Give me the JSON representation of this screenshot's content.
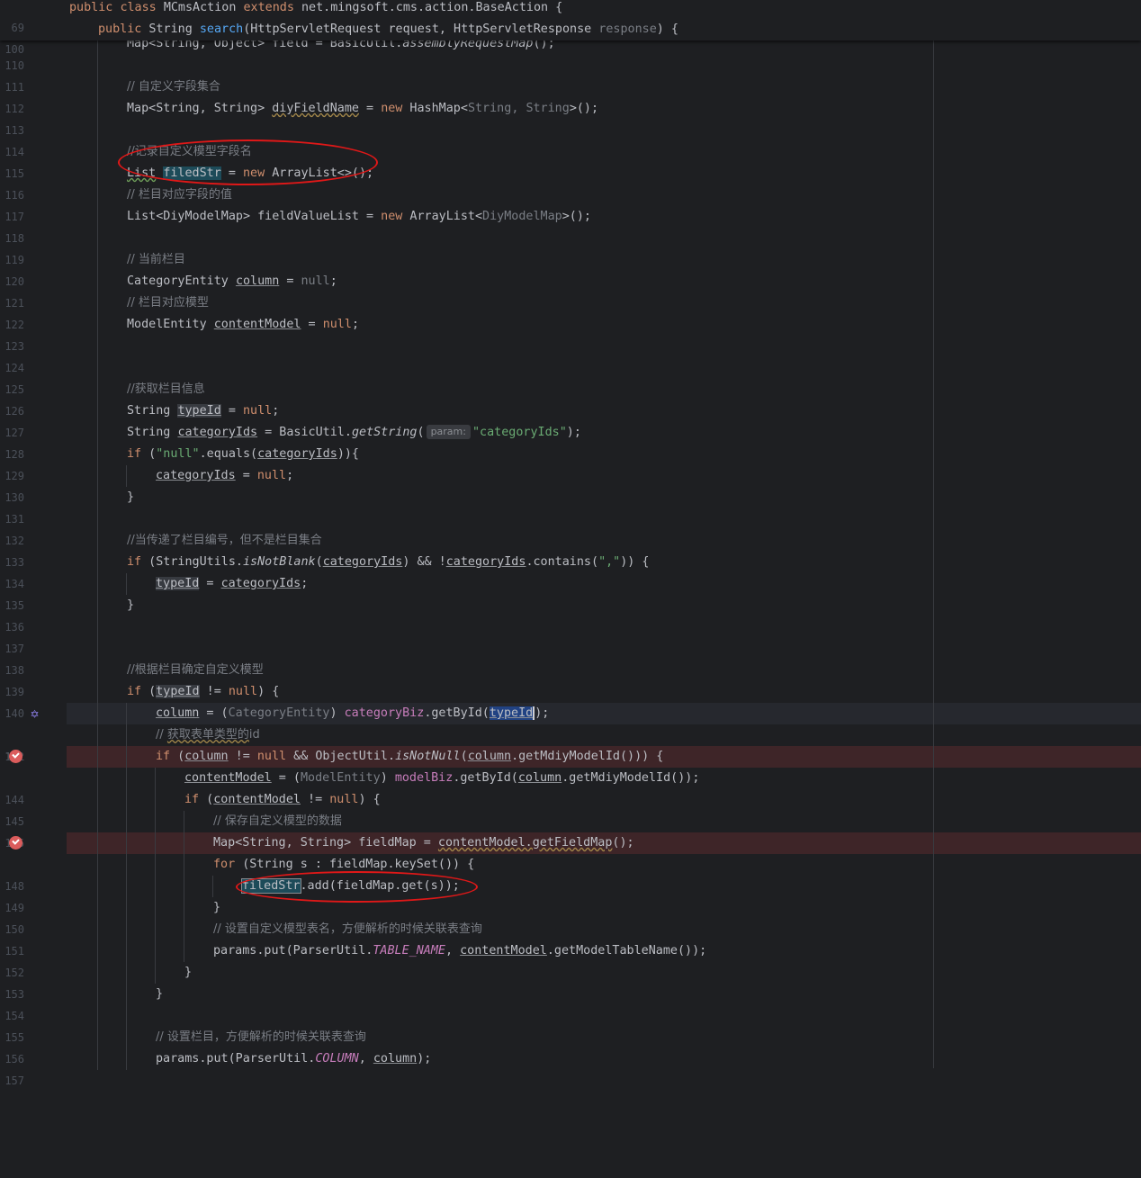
{
  "sticky": {
    "l69": {
      "num": "69",
      "kw1": "public",
      "kw2": "class",
      "name": "MCmsAction",
      "kw3": "extends",
      "base": "net.mingsoft.cms.action.BaseAction {"
    },
    "l100": {
      "num": "100",
      "kw1": "public",
      "t1": " String ",
      "method": "search",
      "p1": "(HttpServletRequest request, HttpServletResponse ",
      "resp": "response",
      "p2": ") {"
    }
  },
  "lines": {
    "l110": {
      "num": "110",
      "a": "Map<String, Object> field = BasicUtil.",
      "b": "assemblyRequestMap",
      "c": "();"
    },
    "l111": {
      "num": "111"
    },
    "l112": {
      "num": "112",
      "cm": "// 自定义字段集合"
    },
    "l113": {
      "num": "113",
      "a": "Map<String, String> ",
      "v": "diyFieldName",
      "b": " = ",
      "kw": "new",
      "c": " HashMap<",
      "d": "String",
      "e": ", ",
      "f": "String",
      "g": ">();"
    },
    "l114": {
      "num": "114"
    },
    "l115": {
      "num": "115",
      "cm": "//记录自定义模型字段名"
    },
    "l116": {
      "num": "116",
      "a": "List",
      "b": " ",
      "v": "filedStr",
      "c": " = ",
      "kw": "new",
      "d": " ArrayList<>();"
    },
    "l117": {
      "num": "117",
      "cm": "// 栏目对应字段的值"
    },
    "l118": {
      "num": "118",
      "a": "List<DiyModelMap> fieldValueList = ",
      "kw": "new",
      "b": " ArrayList<",
      "c": "DiyModelMap",
      "d": ">();"
    },
    "l119": {
      "num": "119"
    },
    "l120": {
      "num": "120",
      "cm": "// 当前栏目"
    },
    "l121": {
      "num": "121",
      "a": "CategoryEntity ",
      "v": "column",
      "b": " = ",
      "n": "null",
      "c": ";"
    },
    "l122": {
      "num": "122",
      "cm": "// 栏目对应模型"
    },
    "l123": {
      "num": "123",
      "a": "ModelEntity ",
      "v": "contentModel",
      "b": " = ",
      "kw": "null",
      "c": ";"
    },
    "l124": {
      "num": "124"
    },
    "l125": {
      "num": "125"
    },
    "l126": {
      "num": "126",
      "cm": "//获取栏目信息"
    },
    "l127": {
      "num": "127",
      "a": "String ",
      "v": "typeId",
      "b": " = ",
      "kw": "null",
      "c": ";"
    },
    "l128": {
      "num": "128",
      "a": "String ",
      "v": "categoryIds",
      "b": " = BasicUtil.",
      "m": "getString",
      "c": "(",
      "hint": "param:",
      "s": "\"categoryIds\"",
      "d": ");"
    },
    "l129": {
      "num": "129",
      "kw": "if",
      "a": " (",
      "s": "\"null\"",
      "b": ".equals(",
      "v": "categoryIds",
      "c": ")){"
    },
    "l130": {
      "num": "130",
      "v": "categoryIds",
      "a": " = ",
      "kw": "null",
      "b": ";"
    },
    "l131": {
      "num": "131",
      "a": "}"
    },
    "l132": {
      "num": "132"
    },
    "l133": {
      "num": "133",
      "cm": "//当传递了栏目编号，但不是栏目集合"
    },
    "l134": {
      "num": "134",
      "kw": "if",
      "a": " (StringUtils.",
      "m": "isNotBlank",
      "b": "(",
      "v1": "categoryIds",
      "c": ") && !",
      "v2": "categoryIds",
      "d": ".contains(",
      "s": "\",\"",
      "e": ")) {"
    },
    "l135": {
      "num": "135",
      "v1": "typeId",
      "a": " = ",
      "v2": "categoryIds",
      "b": ";"
    },
    "l136": {
      "num": "136",
      "a": "}"
    },
    "l137": {
      "num": "137"
    },
    "l138": {
      "num": "138"
    },
    "l139": {
      "num": "139",
      "cm": "//根据栏目确定自定义模型"
    },
    "l140": {
      "num": "140",
      "kw": "if",
      "a": " (",
      "v": "typeId",
      "b": " != ",
      "n": "null",
      "c": ") {"
    },
    "l141": {
      "num": "141",
      "v1": "column",
      "a": " = (",
      "cast": "CategoryEntity",
      "b": ") ",
      "f": "categoryBiz",
      "c": ".getById(",
      "v2": "typeId",
      "d": ");"
    },
    "l142": {
      "num": "142",
      "c1": "// ",
      "c2": "获取表单类型的",
      "c3": "id"
    },
    "l143": {
      "num": "143",
      "kw": "if",
      "a": " (",
      "v1": "column",
      "b": " != ",
      "kw2": "null",
      "c": " && ObjectUtil.",
      "m": "isNotNull",
      "d": "(",
      "v2": "column",
      "e": ".getMdiyModelId())) {"
    },
    "l144": {
      "num": "144",
      "v1": "contentModel",
      "a": " = (",
      "cast": "ModelEntity",
      "b": ") ",
      "f": "modelBiz",
      "c": ".getById(",
      "v2": "column",
      "d": ".getMdiyModelId());"
    },
    "l145": {
      "num": "145",
      "kw": "if",
      "a": " (",
      "v": "contentModel",
      "b": " != ",
      "kw2": "null",
      "c": ") {"
    },
    "l146": {
      "num": "146",
      "cm": "// 保存自定义模型的数据"
    },
    "l147": {
      "num": "147",
      "a": "Map<String, String> fieldMap = ",
      "v": "contentModel.getFieldMap",
      "b": "();"
    },
    "l148": {
      "num": "148",
      "kw": "for",
      "a": " (String ",
      "v": "s",
      "b": " : fieldMap.keySet()) {"
    },
    "l149": {
      "num": "149",
      "v": "filedStr",
      "a": ".add(fieldMap.get(s));"
    },
    "l150": {
      "num": "150",
      "a": "}"
    },
    "l151": {
      "num": "151",
      "cm": "// 设置自定义模型表名，方便解析的时候关联表查询"
    },
    "l152": {
      "num": "152",
      "a": "params.put(ParserUtil.",
      "cst": "TABLE_NAME",
      "b": ", ",
      "v": "contentModel",
      "c": ".getModelTableName());"
    },
    "l153": {
      "num": "153",
      "a": "}"
    },
    "l154": {
      "num": "154",
      "a": "}"
    },
    "l155": {
      "num": "155"
    },
    "l156": {
      "num": "156",
      "cm": "// 设置栏目，方便解析的时候关联表查询"
    },
    "l157": {
      "num": "157",
      "a": "params.put(ParserUtil.",
      "cst": "COLUMN",
      "b": ", ",
      "v": "column",
      "c": ");"
    }
  },
  "colors": {
    "background": "#1e1f22",
    "keyword": "#cf8e6d",
    "string": "#6aab73",
    "comment": "#7a7e85",
    "method": "#56a8f5",
    "field": "#c77dbb",
    "breakpoint": "#db5c5c",
    "annotation_oval": "#e01818"
  },
  "icons": {
    "breakpoint": "breakpoint-check-icon",
    "gutter": "ai-assistant-icon"
  }
}
